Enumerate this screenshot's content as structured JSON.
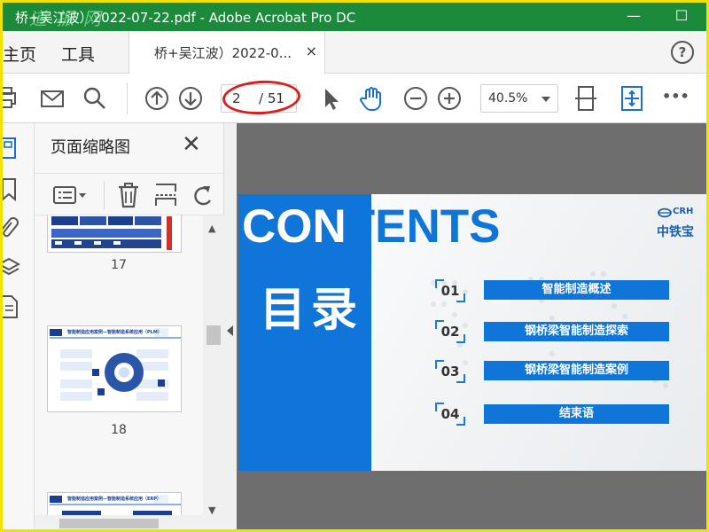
{
  "window": {
    "title": "桥+吴江波）2022-07-22.pdf - Adobe Acrobat Pro DC",
    "watermark": "道 振 网",
    "minimize": "—",
    "maximize": "☐"
  },
  "menubar": {
    "home": "主页",
    "tools": "工具",
    "doc_tab": "桥+吴江波）2022-0...",
    "doc_tab_close": "×",
    "help": "?"
  },
  "toolbar": {
    "page_current": "2",
    "page_total": "/ 51",
    "zoom": "40.5%",
    "more": "•••"
  },
  "panel": {
    "title": "页面缩略图",
    "close": "✕",
    "thumbnails": [
      {
        "label": "17"
      },
      {
        "label": "18",
        "heading": "智能制造应用案例—智能制造系统应用（PLM）"
      },
      {
        "heading": "智能制造应用案例—智能制造系统应用（ERP）"
      }
    ]
  },
  "slide": {
    "contents_white": "CON",
    "contents_blue": "TENTS",
    "mulu": "目录",
    "logo_cn": "中铁宝",
    "logo_en": "CRH",
    "items": [
      {
        "num": "01",
        "label": "智能制造概述"
      },
      {
        "num": "02",
        "label": "钢桥梁智能制造探索"
      },
      {
        "num": "03",
        "label": "钢桥梁智能制造案例"
      },
      {
        "num": "04",
        "label": "结束语"
      }
    ]
  },
  "colors": {
    "titlebar": "#1b8a3b",
    "accent_blue": "#0f75d9",
    "annotation_red": "#d8201f",
    "frame_yellow": "#f2e200"
  }
}
